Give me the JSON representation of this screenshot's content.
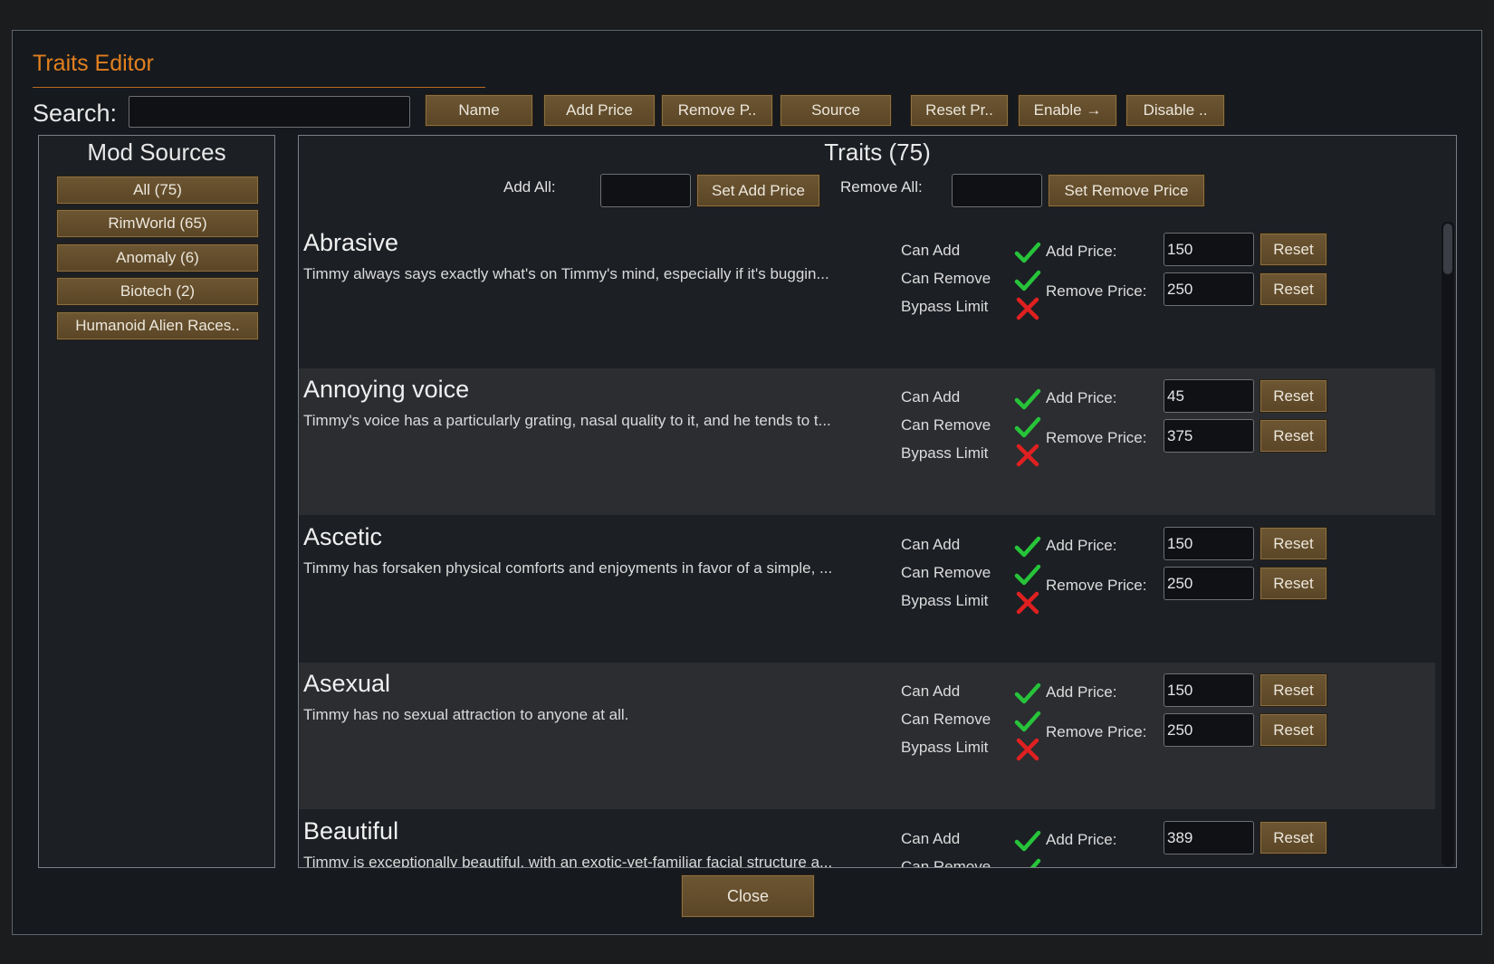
{
  "window": {
    "title": "Traits Editor"
  },
  "search": {
    "label": "Search:",
    "value": ""
  },
  "sort_buttons": [
    "Name",
    "Add Price",
    "Remove P..",
    "Source"
  ],
  "action_buttons": [
    "Reset Pr..",
    "Enable →",
    "Disable .."
  ],
  "sidebar": {
    "title": "Mod Sources",
    "items": [
      "All (75)",
      "RimWorld (65)",
      "Anomaly (6)",
      "Biotech (2)",
      "Humanoid Alien Races.."
    ]
  },
  "main": {
    "title": "Traits (75)",
    "add_all_label": "Add All:",
    "add_all_value": "",
    "set_add_price_label": "Set Add Price",
    "remove_all_label": "Remove All:",
    "remove_all_value": "",
    "set_remove_price_label": "Set Remove Price"
  },
  "row_labels": {
    "can_add": "Can Add",
    "can_remove": "Can Remove",
    "bypass_limit": "Bypass Limit",
    "add_price": "Add Price:",
    "remove_price": "Remove Price:",
    "reset": "Reset"
  },
  "icons": {
    "check_color": "#27c43a",
    "cross_color": "#e02020"
  },
  "traits": [
    {
      "name": "Abrasive",
      "desc": "Timmy always says exactly what's on Timmy's mind, especially if it's buggin...",
      "can_add": true,
      "can_remove": true,
      "bypass_limit": false,
      "add_price": "150",
      "remove_price": "250"
    },
    {
      "name": "Annoying voice",
      "desc": "Timmy's voice has a particularly grating, nasal quality to it, and he tends to t...",
      "can_add": true,
      "can_remove": true,
      "bypass_limit": false,
      "add_price": "45",
      "remove_price": "375"
    },
    {
      "name": "Ascetic",
      "desc": "Timmy has forsaken physical comforts and enjoyments in favor of a simple, ...",
      "can_add": true,
      "can_remove": true,
      "bypass_limit": false,
      "add_price": "150",
      "remove_price": "250"
    },
    {
      "name": "Asexual",
      "desc": "Timmy has no sexual attraction to anyone at all.",
      "can_add": true,
      "can_remove": true,
      "bypass_limit": false,
      "add_price": "150",
      "remove_price": "250"
    },
    {
      "name": "Beautiful",
      "desc": "Timmy is exceptionally beautiful, with an exotic-yet-familiar facial structure a...",
      "can_add": true,
      "can_remove": true,
      "bypass_limit": false,
      "add_price": "389",
      "remove_price": ""
    }
  ],
  "footer": {
    "close_label": "Close"
  }
}
